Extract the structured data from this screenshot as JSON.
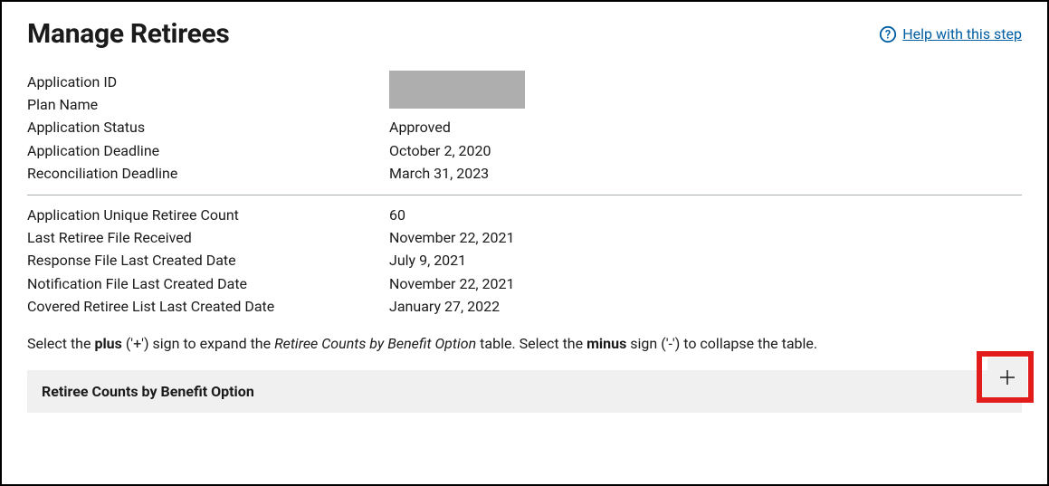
{
  "header": {
    "title": "Manage Retirees",
    "help_link": "Help with this step"
  },
  "details_top": [
    {
      "label": "Application ID",
      "value": "",
      "redacted": true
    },
    {
      "label": "Plan Name",
      "value": "",
      "redacted": true
    },
    {
      "label": "Application Status",
      "value": "Approved"
    },
    {
      "label": "Application Deadline",
      "value": "October 2, 2020"
    },
    {
      "label": "Reconciliation Deadline",
      "value": "March 31, 2023"
    }
  ],
  "details_bottom": [
    {
      "label": "Application Unique Retiree Count",
      "value": "60"
    },
    {
      "label": "Last Retiree File Received",
      "value": "November 22, 2021"
    },
    {
      "label": "Response File Last Created Date",
      "value": "July 9, 2021"
    },
    {
      "label": "Notification File Last Created Date",
      "value": "November 22, 2021"
    },
    {
      "label": "Covered Retiree List Last Created Date",
      "value": "January 27, 2022"
    }
  ],
  "instruction": {
    "p1": "Select the ",
    "bold1": "plus",
    "p2": " ('+') sign to expand the ",
    "italic1": "Retiree Counts by Benefit Option",
    "p3": " table. Select the ",
    "bold2": "minus",
    "p4": " sign ('-') to collapse the table."
  },
  "accordion": {
    "title": "Retiree Counts by Benefit Option"
  }
}
